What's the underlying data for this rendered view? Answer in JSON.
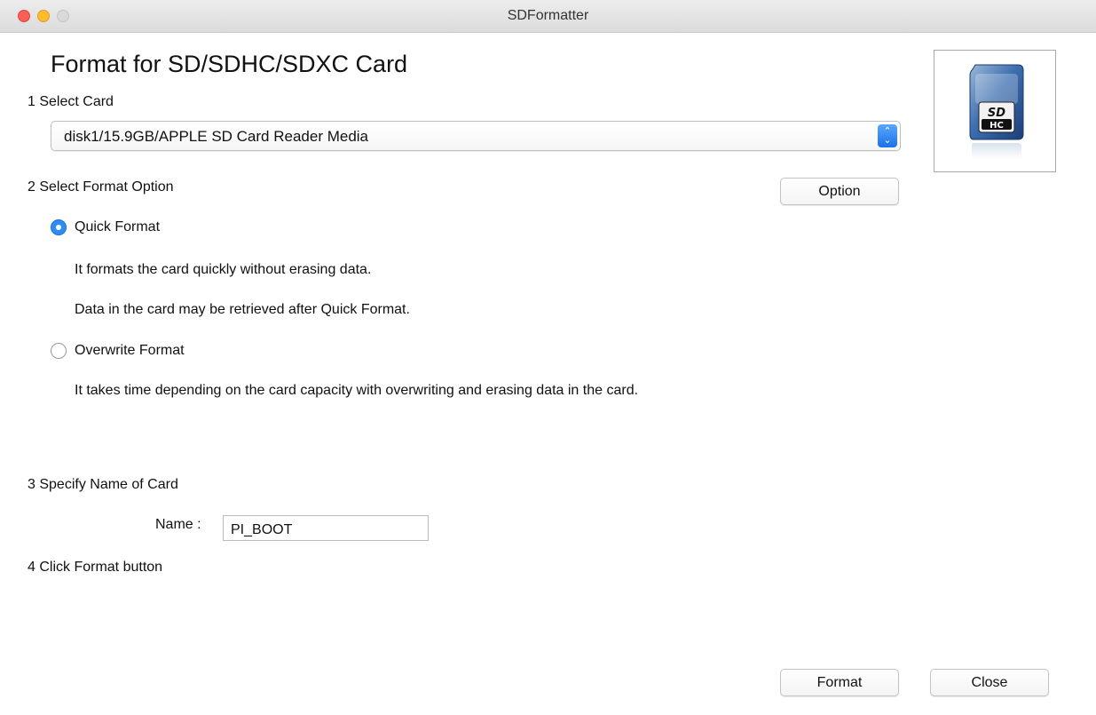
{
  "window": {
    "title": "SDFormatter"
  },
  "header": {
    "heading": "Format for SD/SDHC/SDXC Card"
  },
  "steps": {
    "select_card": "1 Select Card",
    "select_format_option": "2 Select Format Option",
    "specify_name": "3 Specify Name of Card",
    "click_format": "4 Click Format button"
  },
  "card_select": {
    "value": "disk1/15.9GB/APPLE SD Card Reader Media"
  },
  "option_button": {
    "label": "Option"
  },
  "format_options": {
    "quick": {
      "label": "Quick Format",
      "selected": true,
      "desc1": "It formats the card quickly without erasing data.",
      "desc2": "Data in the card may be retrieved after Quick Format."
    },
    "overwrite": {
      "label": "Overwrite Format",
      "selected": false,
      "desc1": "It takes time depending on the card capacity with overwriting and erasing data in the card."
    }
  },
  "name_field": {
    "label": "Name :",
    "value": "PI_BOOT"
  },
  "footer": {
    "format_label": "Format",
    "close_label": "Close"
  },
  "card_image": {
    "logo_top": "SD",
    "logo_bottom": "HC"
  },
  "colors": {
    "accent": "#2f8cf5",
    "close": "#fc5f57",
    "minimize": "#fdbc2e",
    "maximize": "#d9d9d9"
  }
}
